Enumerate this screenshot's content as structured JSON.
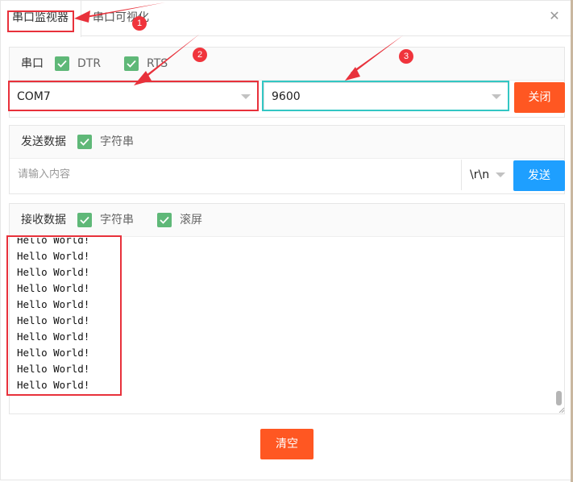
{
  "tabs": [
    {
      "label": "串口监视器"
    },
    {
      "label": "串口可视化"
    }
  ],
  "port_panel": {
    "title": "串口",
    "dtr_label": "DTR",
    "rts_label": "RTS",
    "port_value": "COM7",
    "baud_value": "9600",
    "close_button": "关闭"
  },
  "send_panel": {
    "title": "发送数据",
    "string_label": "字符串",
    "placeholder": "请输入内容",
    "line_ending": "\\r\\n",
    "send_button": "发送"
  },
  "receive_panel": {
    "title": "接收数据",
    "string_label": "字符串",
    "scroll_label": "滚屏",
    "lines": [
      "Hello World!",
      "Hello World!",
      "Hello World!",
      "Hello World!",
      "Hello World!",
      "Hello World!",
      "Hello World!",
      "Hello World!",
      "Hello World!",
      "Hello World!"
    ]
  },
  "clear_button": "清空",
  "annotations": [
    "1",
    "2",
    "3"
  ],
  "colors": {
    "accent_orange": "#ff5722",
    "accent_blue": "#1e9fff",
    "checkbox_green": "#5fb878",
    "annotation_red": "#e8313b",
    "annotation_cyan": "#33c7c4"
  }
}
